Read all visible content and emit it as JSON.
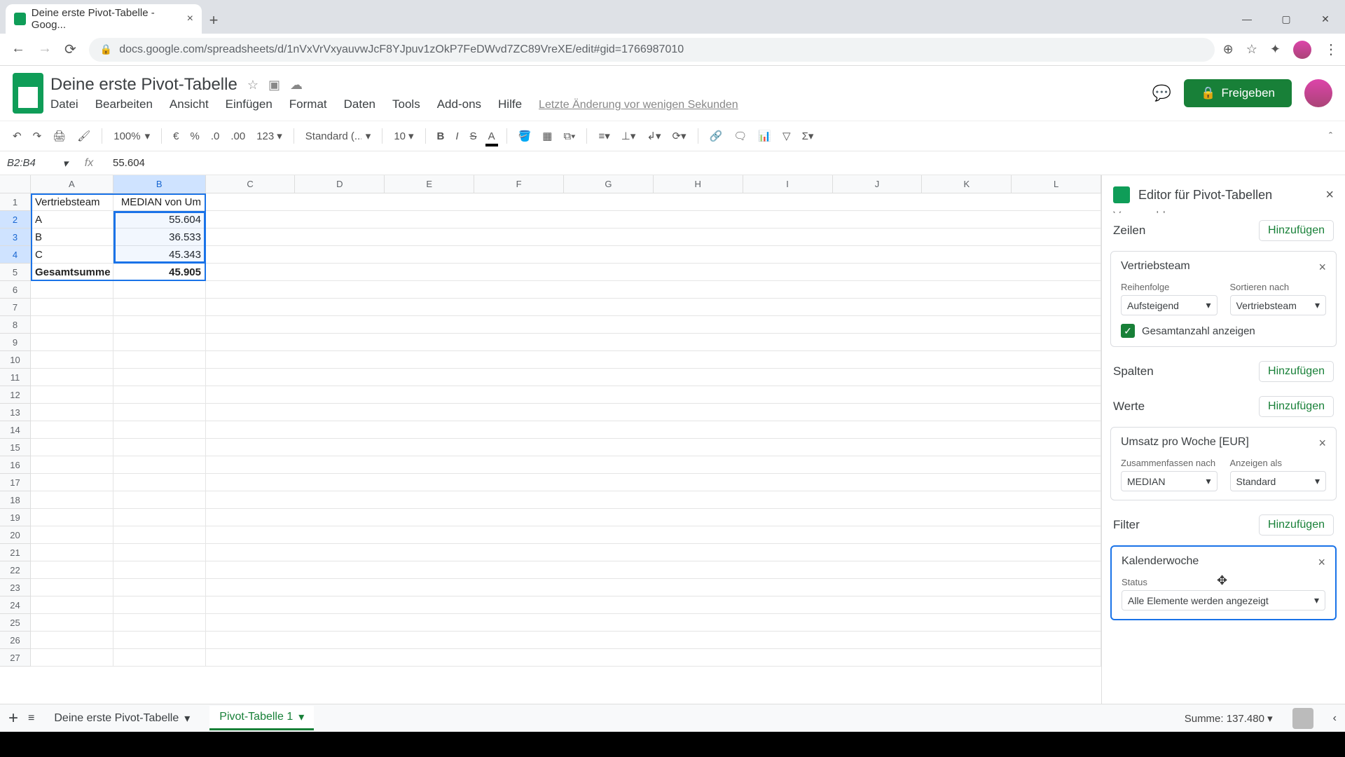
{
  "browser": {
    "tab_title": "Deine erste Pivot-Tabelle - Goog...",
    "url": "docs.google.com/spreadsheets/d/1nVxVrVxyauvwJcF8YJpuv1zOkP7FeDWvd7ZC89VreXE/edit#gid=1766987010"
  },
  "doc": {
    "title": "Deine erste Pivot-Tabelle",
    "menus": [
      "Datei",
      "Bearbeiten",
      "Ansicht",
      "Einfügen",
      "Format",
      "Daten",
      "Tools",
      "Add-ons",
      "Hilfe"
    ],
    "last_edit": "Letzte Änderung vor wenigen Sekunden",
    "share_label": "Freigeben"
  },
  "toolbar": {
    "zoom": "100%",
    "format123": "123",
    "font": "Standard (...",
    "size": "10"
  },
  "namebox": {
    "ref": "B2:B4",
    "fx": "55.604"
  },
  "grid": {
    "cols": [
      "A",
      "B",
      "C",
      "D",
      "E",
      "F",
      "G",
      "H",
      "I",
      "J",
      "K",
      "L"
    ],
    "rows": [
      {
        "n": "1",
        "a": "Vertriebsteam",
        "b": "MEDIAN von Um"
      },
      {
        "n": "2",
        "a": "A",
        "b": "55.604"
      },
      {
        "n": "3",
        "a": "B",
        "b": "36.533"
      },
      {
        "n": "4",
        "a": "C",
        "b": "45.343"
      },
      {
        "n": "5",
        "a": "Gesamtsumme",
        "b": "45.905"
      }
    ],
    "empty_rows": [
      "6",
      "7",
      "8",
      "9",
      "10",
      "11",
      "12",
      "13",
      "14",
      "15",
      "16",
      "17",
      "18",
      "19",
      "20",
      "21",
      "22",
      "23",
      "24",
      "25",
      "26",
      "27"
    ]
  },
  "pivot": {
    "title": "Editor für Pivot-Tabellen",
    "suggested": "Vorgeschlagen",
    "rows_label": "Zeilen",
    "cols_label": "Spalten",
    "values_label": "Werte",
    "filter_label": "Filter",
    "add": "Hinzufügen",
    "row_card": {
      "name": "Vertriebsteam",
      "order_lbl": "Reihenfolge",
      "order": "Aufsteigend",
      "sort_lbl": "Sortieren nach",
      "sort": "Vertriebsteam",
      "totals": "Gesamtanzahl anzeigen"
    },
    "value_card": {
      "name": "Umsatz pro Woche [EUR]",
      "sum_lbl": "Zusammenfassen nach",
      "sum": "MEDIAN",
      "show_lbl": "Anzeigen als",
      "show": "Standard"
    },
    "filter_card": {
      "name": "Kalenderwoche",
      "status_lbl": "Status",
      "status": "Alle Elemente werden angezeigt"
    }
  },
  "tabs": {
    "tab1": "Deine erste Pivot-Tabelle",
    "tab2": "Pivot-Tabelle 1",
    "sum": "Summe: 137.480"
  }
}
